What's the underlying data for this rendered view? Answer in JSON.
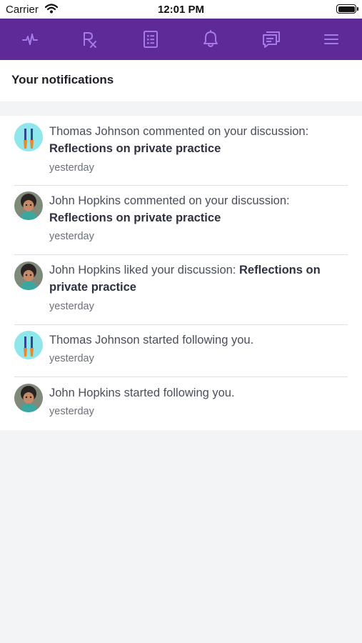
{
  "status_bar": {
    "carrier": "Carrier",
    "time": "12:01 PM"
  },
  "nav": {
    "items": [
      {
        "icon": "pulse-icon"
      },
      {
        "icon": "prescription-icon"
      },
      {
        "icon": "document-list-icon"
      },
      {
        "icon": "bell-icon"
      },
      {
        "icon": "chat-icon"
      },
      {
        "icon": "menu-icon"
      }
    ],
    "accent": "#5d2a97",
    "icon_color": "#a57bea"
  },
  "header": {
    "title": "Your notifications"
  },
  "notifications": [
    {
      "actor": "Thomas Johnson",
      "action": " commented on your discussion: ",
      "target": "Reflections on private practice",
      "time": "yesterday",
      "avatar": "tools-avatar"
    },
    {
      "actor": "John Hopkins",
      "action": " commented on your discussion: ",
      "target": "Reflections on private practice",
      "time": "yesterday",
      "avatar": "child-photo-avatar"
    },
    {
      "actor": "John Hopkins",
      "action": " liked your discussion: ",
      "target": "Reflections on private practice",
      "time": "yesterday",
      "avatar": "child-photo-avatar"
    },
    {
      "actor": "Thomas Johnson",
      "action": " started following you.",
      "target": "",
      "time": "yesterday",
      "avatar": "tools-avatar"
    },
    {
      "actor": "John Hopkins",
      "action": " started following you.",
      "target": "",
      "time": "yesterday",
      "avatar": "child-photo-avatar"
    }
  ]
}
